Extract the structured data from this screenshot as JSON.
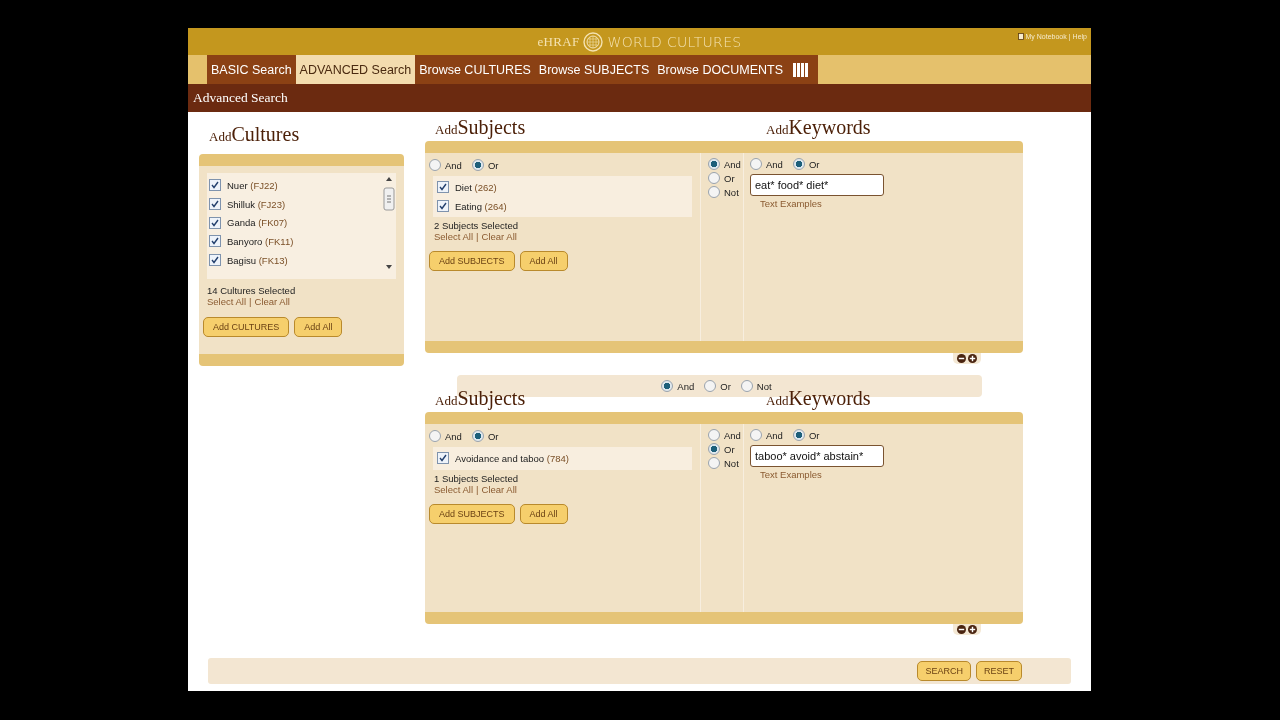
{
  "header": {
    "logo_left": "eHRAF",
    "logo_right": "WORLD CULTURES",
    "links": [
      "My Notebook",
      "Help"
    ],
    "link_separator": "|"
  },
  "tabs": [
    {
      "label": "BASIC Search",
      "selected": false
    },
    {
      "label": "ADVANCED Search",
      "selected": true
    },
    {
      "label": "Browse CULTURES",
      "selected": false
    },
    {
      "label": "Browse SUBJECTS",
      "selected": false
    },
    {
      "label": "Browse DOCUMENTS",
      "selected": false
    }
  ],
  "page_title": "Advanced Search",
  "cultures": {
    "title_prefix": "Add",
    "title": "Cultures",
    "items": [
      {
        "name": "Nuer",
        "code": "(FJ22)",
        "checked": true
      },
      {
        "name": "Shilluk",
        "code": "(FJ23)",
        "checked": true
      },
      {
        "name": "Ganda",
        "code": "(FK07)",
        "checked": true
      },
      {
        "name": "Banyoro",
        "code": "(FK11)",
        "checked": true
      },
      {
        "name": "Bagisu",
        "code": "(FK13)",
        "checked": true
      }
    ],
    "count": "14 Cultures Selected",
    "links": [
      "Select All",
      "Clear All"
    ],
    "link_separator": "|",
    "buttons": [
      "Add CULTURES",
      "Add All"
    ]
  },
  "blocks": [
    {
      "subjects": {
        "title_prefix": "Add",
        "title": "Subjects",
        "mode": [
          {
            "label": "And",
            "selected": false
          },
          {
            "label": "Or",
            "selected": true
          }
        ],
        "items": [
          {
            "name": "Diet",
            "code": "(262)",
            "checked": true
          },
          {
            "name": "Eating",
            "code": "(264)",
            "checked": true
          }
        ],
        "count": "2 Subjects Selected",
        "links": [
          "Select All",
          "Clear All"
        ],
        "link_separator": "|",
        "buttons": [
          "Add SUBJECTS",
          "Add All"
        ]
      },
      "operator": [
        {
          "label": "And",
          "selected": true
        },
        {
          "label": "Or",
          "selected": false
        },
        {
          "label": "Not",
          "selected": false
        }
      ],
      "keywords": {
        "title_prefix": "Add",
        "title": "Keywords",
        "mode": [
          {
            "label": "And",
            "selected": false
          },
          {
            "label": "Or",
            "selected": true
          }
        ],
        "value": "eat* food* diet*",
        "examples": "Text Examples"
      }
    },
    {
      "subjects": {
        "title_prefix": "Add",
        "title": "Subjects",
        "mode": [
          {
            "label": "And",
            "selected": false
          },
          {
            "label": "Or",
            "selected": true
          }
        ],
        "items": [
          {
            "name": "Avoidance and taboo",
            "code": "(784)",
            "checked": true
          }
        ],
        "count": "1 Subjects Selected",
        "links": [
          "Select All",
          "Clear All"
        ],
        "link_separator": "|",
        "buttons": [
          "Add SUBJECTS",
          "Add All"
        ]
      },
      "operator": [
        {
          "label": "And",
          "selected": false
        },
        {
          "label": "Or",
          "selected": true
        },
        {
          "label": "Not",
          "selected": false
        }
      ],
      "keywords": {
        "title_prefix": "Add",
        "title": "Keywords",
        "mode": [
          {
            "label": "And",
            "selected": false
          },
          {
            "label": "Or",
            "selected": true
          }
        ],
        "value": "taboo* avoid* abstain*",
        "examples": "Text Examples"
      }
    }
  ],
  "combine": [
    {
      "label": "And",
      "selected": true
    },
    {
      "label": "Or",
      "selected": false
    },
    {
      "label": "Not",
      "selected": false
    }
  ],
  "footer_buttons": [
    "SEARCH",
    "RESET"
  ]
}
